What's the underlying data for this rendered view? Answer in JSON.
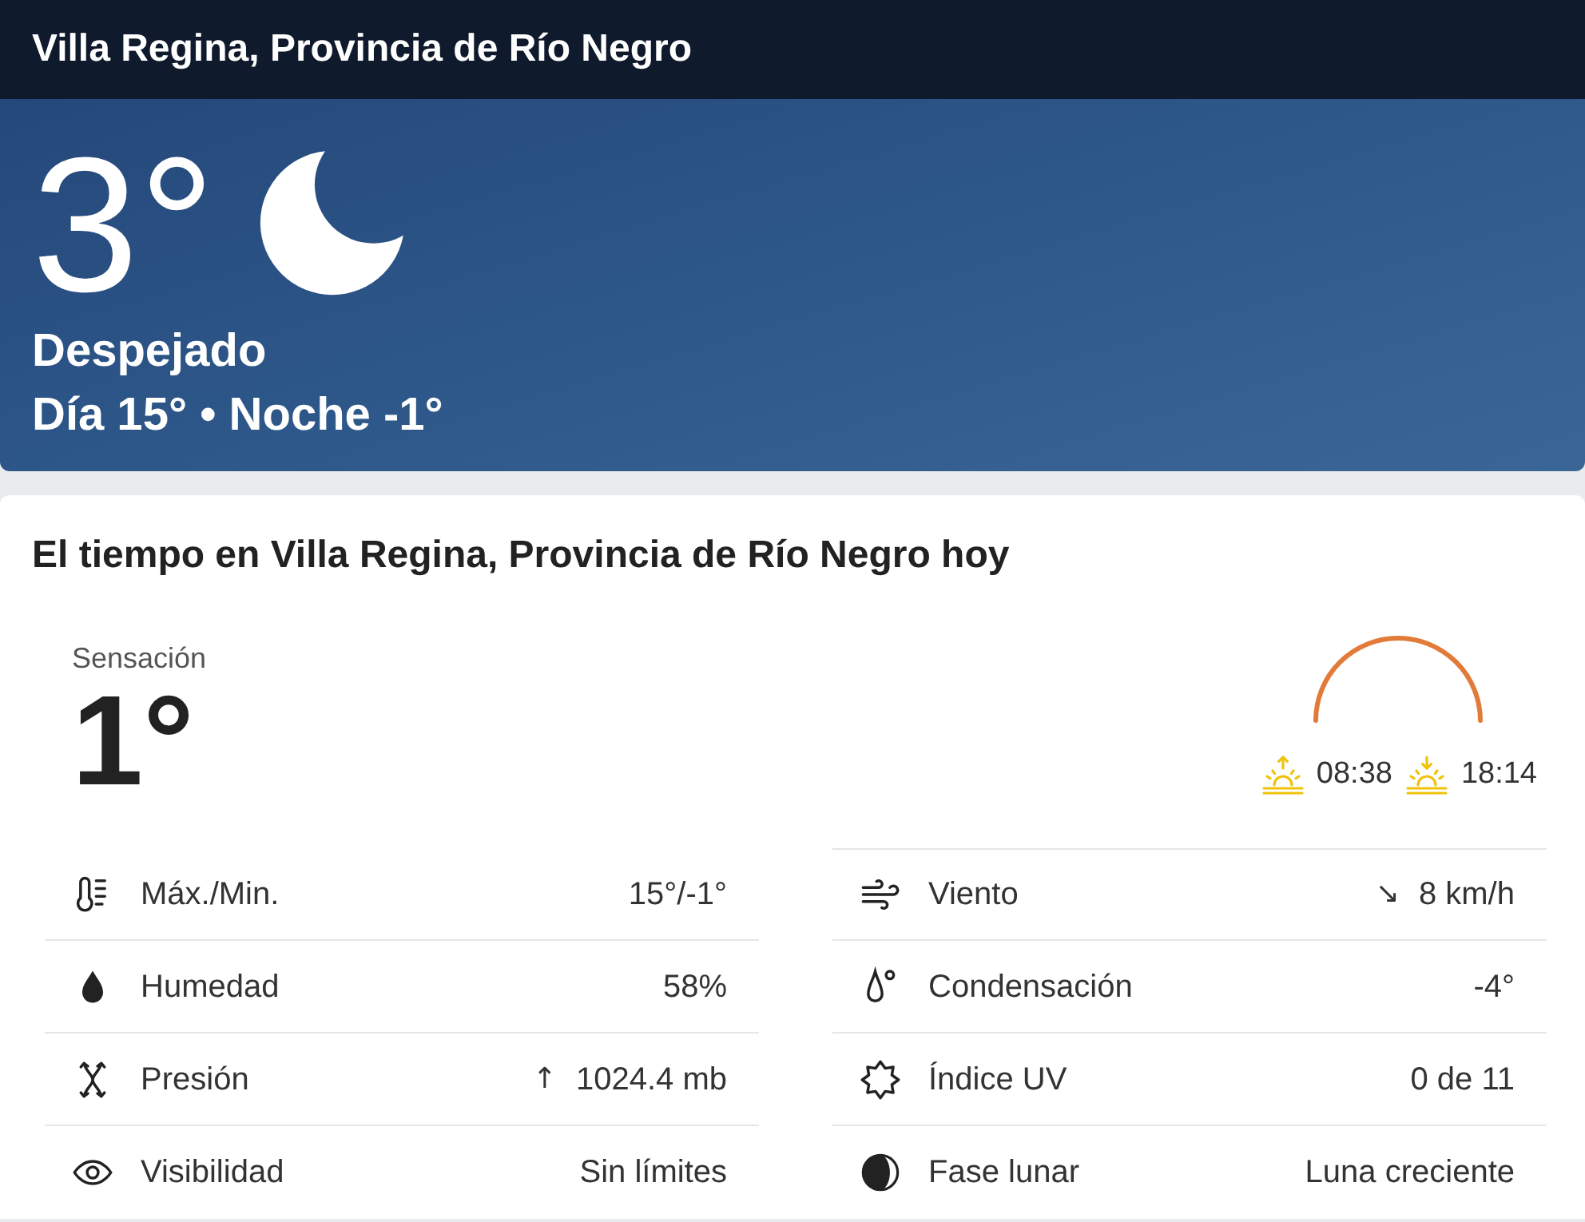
{
  "header": {
    "location": "Villa Regina, Provincia de Río Negro"
  },
  "current": {
    "temperature": "3°",
    "condition": "Despejado",
    "day_night": "Día 15° • Noche -1°"
  },
  "today": {
    "title": "El tiempo en Villa Regina, Provincia de Río Negro hoy",
    "feels_like": {
      "label": "Sensación",
      "value": "1°"
    },
    "sun": {
      "sunrise": "08:38",
      "sunset": "18:14"
    },
    "details_left": [
      {
        "kind": "maxmin",
        "label": "Máx./Min.",
        "value": "15°/-1°"
      },
      {
        "kind": "humidity",
        "label": "Humedad",
        "value": "58%"
      },
      {
        "kind": "pressure",
        "label": "Presión",
        "arrow": "↑",
        "value": "1024.4 mb"
      },
      {
        "kind": "visibility",
        "label": "Visibilidad",
        "value": "Sin límites"
      }
    ],
    "details_right": [
      {
        "kind": "wind",
        "label": "Viento",
        "arrow": "↘",
        "value": "8 km/h"
      },
      {
        "kind": "dewpoint",
        "label": "Condensación",
        "value": "-4°"
      },
      {
        "kind": "uv",
        "label": "Índice UV",
        "value": "0 de 11"
      },
      {
        "kind": "moonphase",
        "label": "Fase lunar",
        "value": "Luna creciente"
      }
    ]
  }
}
